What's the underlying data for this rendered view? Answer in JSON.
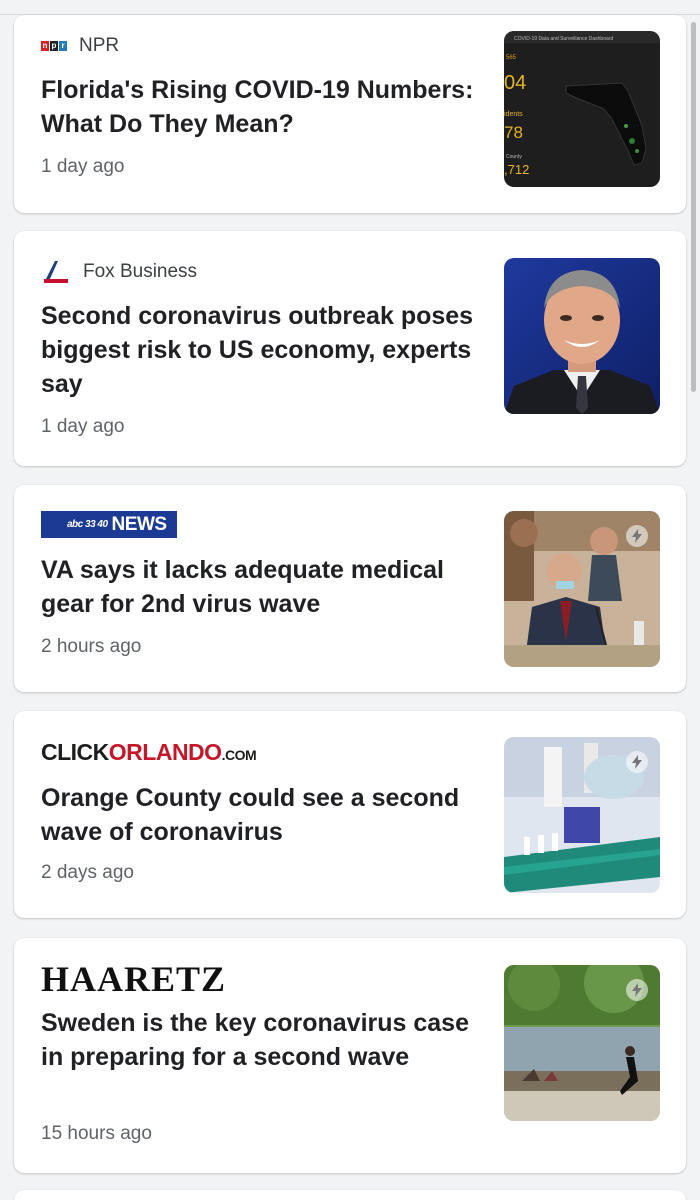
{
  "articles": [
    {
      "source": "NPR",
      "logo_icon": "npr-logo-icon",
      "headline": "Florida's Rising COVID-19 Numbers: What Do They Mean?",
      "time": "1 day ago",
      "thumb": {
        "header": "COVID-19 Data and Surveillance Dashboard",
        "lines": [
          "04",
          "idents",
          "78",
          "County",
          ",712"
        ]
      }
    },
    {
      "source": "Fox Business",
      "logo_icon": "fox-business-logo-icon",
      "headline": "Second coronavirus outbreak poses biggest risk to US economy, experts say",
      "time": "1 day ago"
    },
    {
      "source": "NEWS",
      "source_prefix": "abc 33 40",
      "logo_icon": "abc-news-logo-icon",
      "headline": "VA says it lacks adequate medical gear for 2nd virus wave",
      "time": "2 hours ago"
    },
    {
      "source_parts": [
        "CLICK",
        "ORLANDO",
        ".COM"
      ],
      "logo_icon": "clickorlando-logo-icon",
      "headline": "Orange County could see a second wave of coronavirus",
      "time": "2 days ago"
    },
    {
      "source": "HAARETZ",
      "logo_icon": "haaretz-logo-icon",
      "headline": "Sweden is the key coronavirus case in preparing for a second wave",
      "time": "15 hours ago"
    }
  ],
  "colors": {
    "background": "#f1f3f4",
    "card": "#ffffff",
    "headline": "#202124",
    "meta": "#5f6368",
    "abc_blue": "#1b3a94",
    "clickorlando_red": "#c5172a",
    "fox_red": "#c8102e",
    "fox_blue": "#1c3d7a"
  },
  "icons": [
    "amp-lightning-icon"
  ]
}
